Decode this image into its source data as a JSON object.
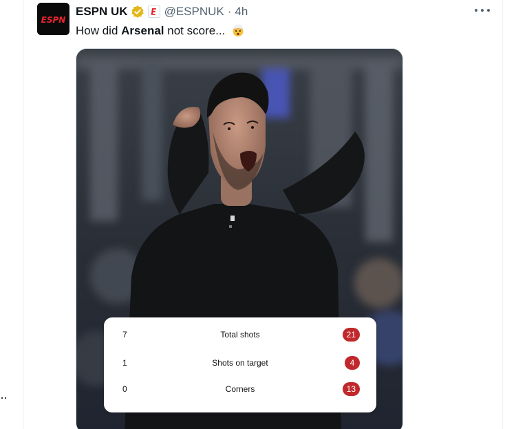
{
  "tweet": {
    "author_name": "ESPN UK",
    "handle": "@ESPNUK",
    "separator": "·",
    "time": "4h",
    "text_pre": "How did ",
    "text_bold": "Arsenal",
    "text_post": " not score...",
    "avatar_text": "ESPN"
  },
  "stats": [
    {
      "left": "7",
      "label": "Total shots",
      "right": "21"
    },
    {
      "left": "1",
      "label": "Shots on target",
      "right": "4"
    },
    {
      "left": "0",
      "label": "Corners",
      "right": "13"
    }
  ],
  "colors": {
    "accent": "#1d9bf0",
    "espn_red": "#e8222a",
    "badge_red": "#c0282b",
    "verified_gold": "#e2b719",
    "muted_text": "#536471"
  },
  "icons": {
    "verified": "verified-gold-badge-icon",
    "affiliate": "espn-affiliate-icon",
    "more": "more-horizontal-icon",
    "emoji": "exploding-head-emoji"
  }
}
